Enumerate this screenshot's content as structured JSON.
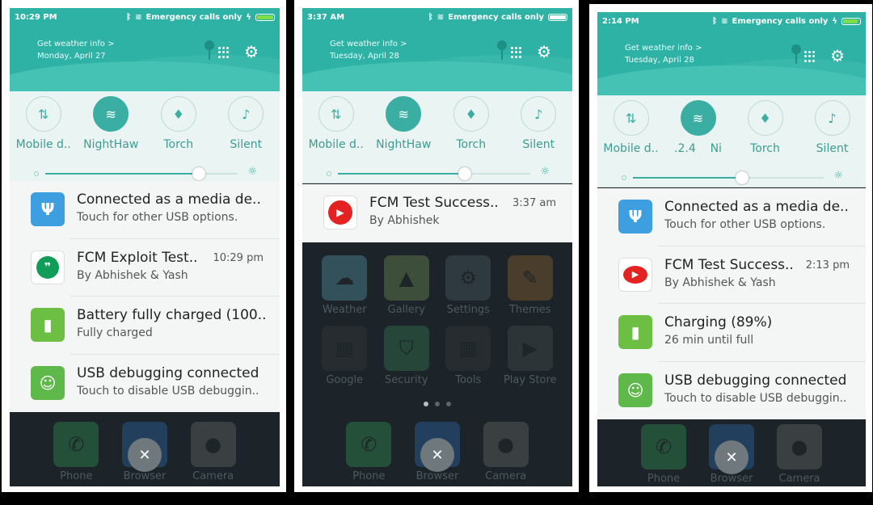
{
  "screens": [
    {
      "status": {
        "time": "10:29 PM",
        "carrier": "Emergency calls only"
      },
      "weather": {
        "title": "Get weather info >",
        "date": "Monday, April 27"
      },
      "tiles": [
        {
          "label": "Mobile d..",
          "icon": "mobile-data-icon",
          "glyph": "⇅",
          "on": false
        },
        {
          "label": "NightHaw",
          "icon": "wifi-icon",
          "glyph": "≋",
          "on": true
        },
        {
          "label": "Torch",
          "icon": "torch-icon",
          "glyph": "♦",
          "on": false
        },
        {
          "label": "Silent",
          "icon": "bell-off-icon",
          "glyph": "♪",
          "on": false
        }
      ],
      "brightness": 0.8,
      "notifications": [
        {
          "title": "Connected as a media de..",
          "subtitle": "Touch for other USB options.",
          "time": "",
          "icon": "usb-icon",
          "color": "#3d9fe0"
        },
        {
          "title": "FCM Exploit Test..",
          "subtitle": "By Abhishek & Yash",
          "time": "10:29 pm",
          "icon": "hangouts-icon",
          "color": "#ffffff"
        },
        {
          "title": "Battery fully charged (100..",
          "subtitle": "Fully charged",
          "time": "",
          "icon": "battery-icon",
          "color": "#6dbf43"
        },
        {
          "title": "USB debugging connected",
          "subtitle": "Touch to disable USB debuggin..",
          "time": "",
          "icon": "android-icon",
          "color": "#5fb84a"
        }
      ],
      "dock": [
        "Phone",
        "Browser",
        "Camera"
      ]
    },
    {
      "status": {
        "time": "3:37 AM",
        "carrier": "Emergency calls only"
      },
      "weather": {
        "title": "Get weather info >",
        "date": "Tuesday, April 28"
      },
      "tiles": [
        {
          "label": "Mobile d..",
          "icon": "mobile-data-icon",
          "glyph": "⇅",
          "on": false
        },
        {
          "label": "NightHaw",
          "icon": "wifi-icon",
          "glyph": "≋",
          "on": true
        },
        {
          "label": "Torch",
          "icon": "torch-icon",
          "glyph": "♦",
          "on": false
        },
        {
          "label": "Silent",
          "icon": "bell-off-icon",
          "glyph": "♪",
          "on": false
        }
      ],
      "brightness": 0.66,
      "notifications": [
        {
          "title": "FCM Test Success..",
          "subtitle": "By Abhishek",
          "time": "3:37 am",
          "icon": "youtube-icon",
          "color": "#ffffff"
        }
      ],
      "apps": [
        {
          "name": "Weather",
          "icon": "weather-icon"
        },
        {
          "name": "Gallery",
          "icon": "gallery-icon"
        },
        {
          "name": "Settings",
          "icon": "settings-icon"
        },
        {
          "name": "Themes",
          "icon": "themes-icon"
        },
        {
          "name": "Google",
          "icon": "google-folder-icon"
        },
        {
          "name": "Security",
          "icon": "security-icon"
        },
        {
          "name": "Tools",
          "icon": "tools-folder-icon"
        },
        {
          "name": "Play Store",
          "icon": "play-store-icon"
        }
      ],
      "dock": [
        "Phone",
        "Browser",
        "Camera"
      ]
    },
    {
      "status": {
        "time": "2:14 PM",
        "carrier": "Emergency calls only"
      },
      "weather": {
        "title": "Get weather info >",
        "date": "Tuesday, April 28"
      },
      "tiles": [
        {
          "label": "Mobile d..",
          "icon": "mobile-data-icon",
          "glyph": "⇅",
          "on": false
        },
        {
          "label": ".2.4    Ni",
          "icon": "wifi-icon",
          "glyph": "≋",
          "on": true
        },
        {
          "label": "Torch",
          "icon": "torch-icon",
          "glyph": "♦",
          "on": false
        },
        {
          "label": "Silent",
          "icon": "bell-off-icon",
          "glyph": "♪",
          "on": false
        }
      ],
      "brightness": 0.57,
      "notifications": [
        {
          "title": "Connected as a media de..",
          "subtitle": "Touch for other USB options.",
          "time": "",
          "icon": "usb-icon",
          "color": "#3d9fe0"
        },
        {
          "title": "FCM Test Success..",
          "subtitle": "By Abhishek & Yash",
          "time": "2:13 pm",
          "icon": "youtube-icon",
          "color": "#ffffff"
        },
        {
          "title": "Charging (89%)",
          "subtitle": "26 min until full",
          "time": "",
          "icon": "battery-icon",
          "color": "#6dbf43"
        },
        {
          "title": "USB debugging connected",
          "subtitle": "Touch to disable USB debuggin..",
          "time": "",
          "icon": "android-icon",
          "color": "#5fb84a"
        }
      ],
      "dock": [
        "Phone",
        "Browser",
        "Camera"
      ]
    }
  ],
  "colors": {
    "teal": "#2fb2a6",
    "panel": "#eaf4f2",
    "home_bg": "#1c242a"
  }
}
